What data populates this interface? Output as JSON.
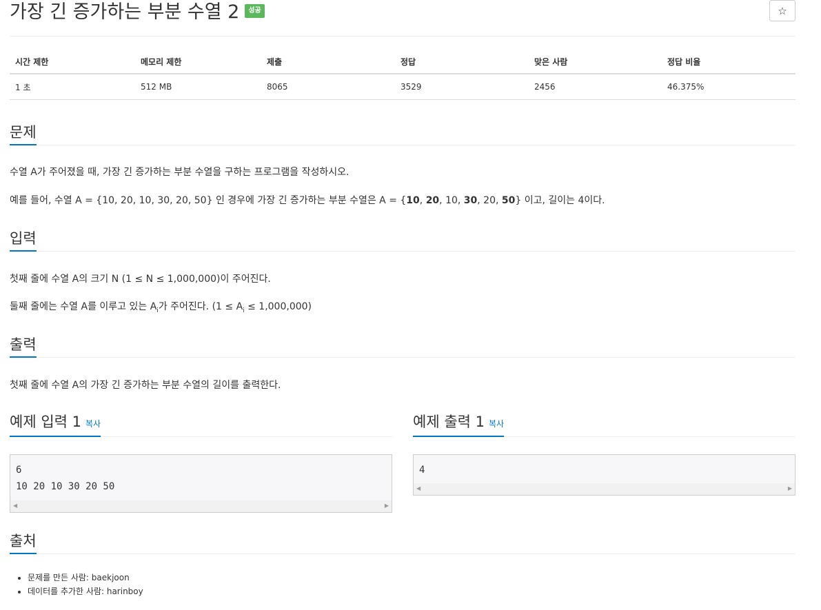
{
  "problem": {
    "title": "가장 긴 증가하는 부분 수열 2",
    "badge": "성공",
    "star_icon": "☆"
  },
  "info_table": {
    "headers": [
      "시간 제한",
      "메모리 제한",
      "제출",
      "정답",
      "맞은 사람",
      "정답 비율"
    ],
    "values": [
      "1 초",
      "512 MB",
      "8065",
      "3529",
      "2456",
      "46.375%"
    ]
  },
  "sections": {
    "problem_heading": "문제",
    "problem_line1": "수열 A가 주어졌을 때, 가장 긴 증가하는 부분 수열을 구하는 프로그램을 작성하시오.",
    "problem_line2_a": "예를 들어, 수열 A = {10, 20, 10, 30, 20, 50} 인 경우에 가장 긴 증가하는 부분 수열은 A = {",
    "problem_line2_b1": "10",
    "problem_line2_s1": ", ",
    "problem_line2_b2": "20",
    "problem_line2_s2": ", 10, ",
    "problem_line2_b3": "30",
    "problem_line2_s3": ", 20, ",
    "problem_line2_b4": "50",
    "problem_line2_c": "} 이고, 길이는 4이다.",
    "input_heading": "입력",
    "input_line1": "첫째 줄에 수열 A의 크기 N (1 ≤ N ≤ 1,000,000)이 주어진다.",
    "input_line2_a": "둘째 줄에는 수열 A를 이루고 있는 A",
    "input_line2_sub": "i",
    "input_line2_b": "가 주어진다. (1 ≤ A",
    "input_line2_sub2": "i",
    "input_line2_c": " ≤ 1,000,000)",
    "output_heading": "출력",
    "output_line1": "첫째 줄에 수열 A의 가장 긴 증가하는 부분 수열의 길이를 출력한다.",
    "sample_input_heading": "예제 입력 1",
    "sample_output_heading": "예제 출력 1",
    "copy_label": "복사",
    "sample_input": "6\n10 20 10 30 20 50",
    "sample_output": "4",
    "source_heading": "출처",
    "source_items": [
      "문제를 만든 사람: baekjoon",
      "데이터를 추가한 사람: harinboy"
    ]
  }
}
